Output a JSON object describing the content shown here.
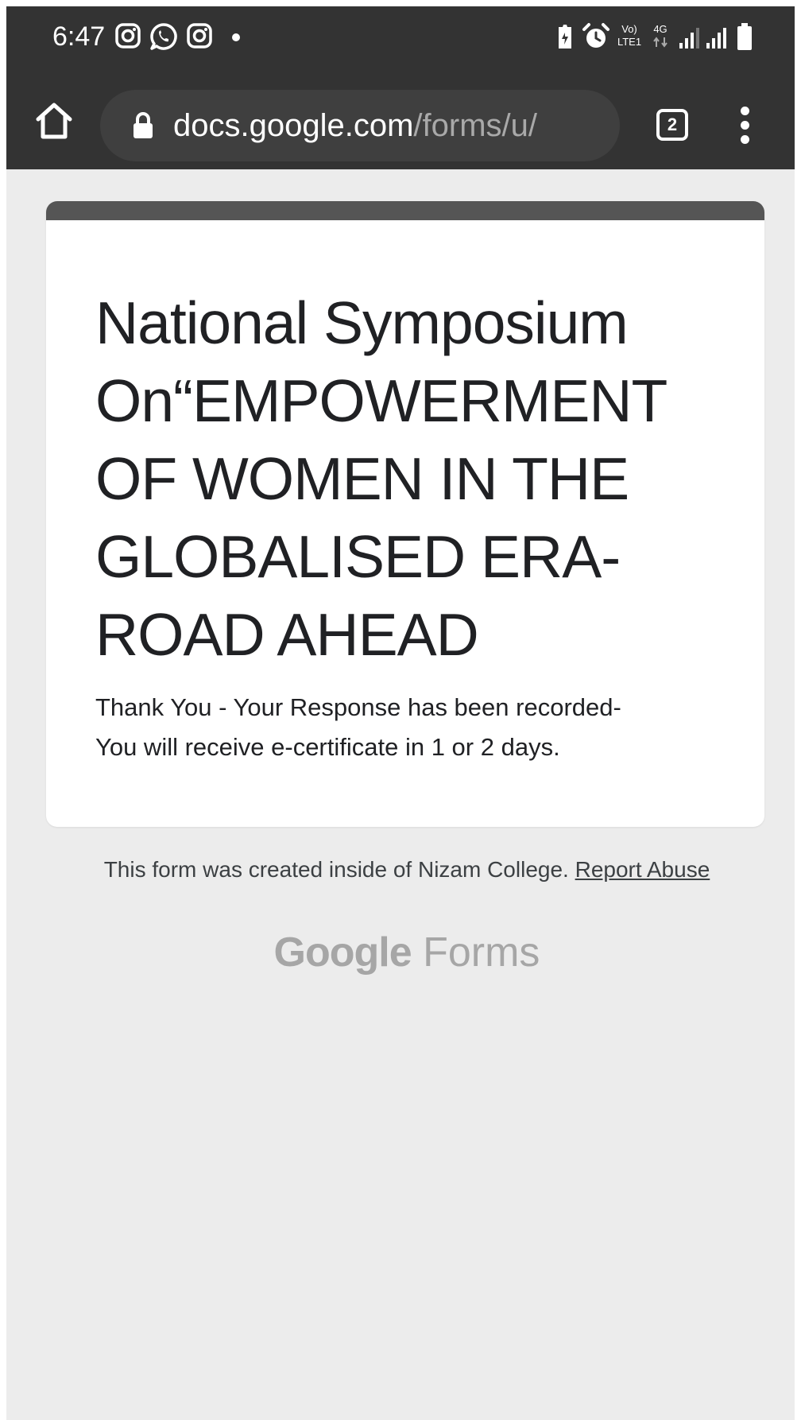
{
  "status_bar": {
    "time": "6:47",
    "net_label_top": "Vo)",
    "net_label_bottom": "LTE1",
    "net_type": "4G"
  },
  "browser": {
    "url_host": "docs.google.com",
    "url_path": "/forms/u/",
    "tab_count": "2"
  },
  "form": {
    "title": "National Symposium On“EMPOWERMENT OF WOMEN IN THE GLOBALISED ERA-ROAD AHEAD",
    "confirmation_line1": "Thank You - Your Response has been recorded-",
    "confirmation_line2": "You will receive e-certificate in 1 or 2 days."
  },
  "footer": {
    "note": "This form was created inside of Nizam College.",
    "report_link": "Report Abuse",
    "brand_google": "Google",
    "brand_forms": "Forms"
  },
  "colors": {
    "chrome": "#333333",
    "page_background": "#ececec",
    "card_accent": "#555555"
  },
  "icons": [
    "instagram-icon",
    "whatsapp-icon",
    "instagram-icon",
    "notification-dot-icon",
    "battery-saver-icon",
    "alarm-icon",
    "volte-icon",
    "4g-data-icon",
    "signal-icon",
    "signal-icon",
    "battery-icon",
    "home-icon",
    "lock-icon",
    "tab-switcher-icon",
    "overflow-menu-icon"
  ]
}
